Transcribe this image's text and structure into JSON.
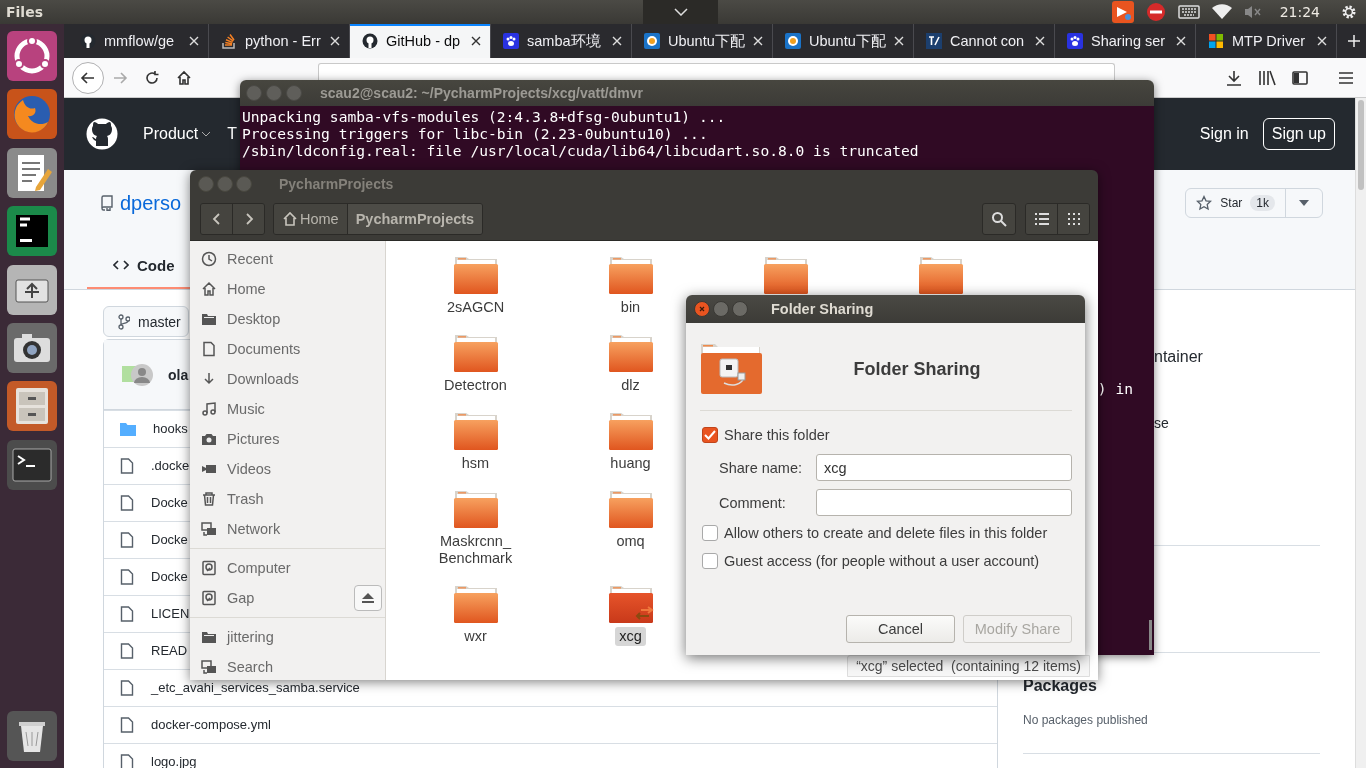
{
  "top_panel": {
    "app_title": "Files",
    "clock": "21:24"
  },
  "browser": {
    "tabs": [
      {
        "kind": "circle",
        "label": "mmflow/ge",
        "selected": false
      },
      {
        "kind": "stack",
        "label": "python - Err",
        "selected": false
      },
      {
        "kind": "circle",
        "label": "GitHub - dp",
        "selected": true
      },
      {
        "kind": "paw",
        "label": "samba环境",
        "selected": false
      },
      {
        "kind": "ring",
        "label": "Ubuntu下配",
        "selected": false
      },
      {
        "kind": "ring",
        "label": "Ubuntu下配",
        "selected": false
      },
      {
        "kind": "slash",
        "label": "Cannot con",
        "selected": false
      },
      {
        "kind": "paw",
        "label": "Sharing ser",
        "selected": false
      },
      {
        "kind": "squares",
        "label": "MTP Driver",
        "selected": false
      }
    ]
  },
  "github": {
    "nav": [
      "Product",
      "T"
    ],
    "sign_in": "Sign in",
    "sign_up": "Sign up",
    "owner": "dperso",
    "star": "Star",
    "star_count": "1k",
    "tabs": [
      {
        "label": "Code",
        "selected": true
      }
    ],
    "branch": "master",
    "author": "ola",
    "files": [
      {
        "kind": "folder",
        "name": "hooks"
      },
      {
        "kind": "file",
        "name": ".docke"
      },
      {
        "kind": "file",
        "name": "Docke"
      },
      {
        "kind": "file",
        "name": "Docke"
      },
      {
        "kind": "file",
        "name": "Docke"
      },
      {
        "kind": "file",
        "name": "LICEN"
      },
      {
        "kind": "file",
        "name": "READ"
      },
      {
        "kind": "file",
        "name": "_etc_avahi_services_samba.service"
      },
      {
        "kind": "file",
        "name": "docker-compose.yml"
      },
      {
        "kind": "file",
        "name": "logo.jpg"
      }
    ],
    "about_fragments": [
      "ntainer",
      "se"
    ],
    "packages_title": "Packages",
    "packages_note": "No packages published"
  },
  "terminal": {
    "title": "scau2@scau2: ~/PycharmProjects/xcg/vatt/dmvr",
    "lines": [
      "Unpacking samba-vfs-modules (2:4.3.8+dfsg-0ubuntu1) ...",
      "Processing triggers for libc-bin (2.23-0ubuntu10) ...",
      "/sbin/ldconfig.real: file /usr/local/cuda/lib64/libcudart.so.8.0 is truncated"
    ],
    "tail": ") in"
  },
  "files": {
    "title": "PycharmProjects",
    "path": [
      {
        "label": "Home",
        "selected": false
      },
      {
        "label": "PycharmProjects",
        "selected": true
      }
    ],
    "sidebar": [
      {
        "items": [
          {
            "kind": "recent",
            "label": "Recent"
          },
          {
            "kind": "home",
            "label": "Home"
          },
          {
            "kind": "folder",
            "label": "Desktop"
          },
          {
            "kind": "document",
            "label": "Documents"
          },
          {
            "kind": "download",
            "label": "Downloads"
          },
          {
            "kind": "music",
            "label": "Music"
          },
          {
            "kind": "camera",
            "label": "Pictures"
          },
          {
            "kind": "video",
            "label": "Videos"
          },
          {
            "kind": "trash",
            "label": "Trash"
          },
          {
            "kind": "network",
            "label": "Network"
          }
        ]
      },
      {
        "items": [
          {
            "kind": "drive",
            "label": "Computer"
          },
          {
            "kind": "mount",
            "label": "Gap"
          }
        ]
      },
      {
        "items": [
          {
            "kind": "folder",
            "label": "jittering"
          },
          {
            "kind": "network",
            "label": "Search"
          }
        ]
      }
    ],
    "rows": [
      [
        {
          "name": "2sAGCN",
          "selected": false,
          "shared": false
        },
        {
          "name": "bin",
          "selected": false,
          "shared": false
        },
        {
          "shared": false
        },
        {
          "shared": false
        }
      ],
      [
        {
          "name": "Detectron",
          "selected": false,
          "shared": false
        },
        {
          "name": "dlz",
          "selected": false,
          "shared": false
        }
      ],
      [
        {
          "name": "hsm",
          "selected": false,
          "shared": false
        },
        {
          "name": "huang",
          "selected": false,
          "shared": false
        }
      ],
      [
        {
          "name": "Maskrcnn_Benchmark",
          "selected": false,
          "shared": false
        },
        {
          "name": "omq",
          "selected": false,
          "shared": false
        }
      ],
      [
        {
          "name": "wxr",
          "selected": false,
          "shared": false
        },
        {
          "name": "xcg",
          "selected": true,
          "shared": true
        }
      ]
    ],
    "status": "“xcg” selected  (containing 12 items)"
  },
  "share_dialog": {
    "title": "Folder Sharing",
    "heading": "Folder Sharing",
    "options": [
      {
        "kind": "checkbox",
        "label": "Share this folder",
        "checked": true
      },
      {
        "kind": "field",
        "label": "Share name:",
        "value": "xcg"
      },
      {
        "kind": "field",
        "label": "Comment:"
      },
      {
        "kind": "checkbox",
        "label": "Allow others to create and delete files in this folder",
        "checked": false
      },
      {
        "kind": "checkbox",
        "label": "Guest access (for people without a user account)",
        "checked": false
      }
    ],
    "buttons": [
      {
        "label": "Cancel",
        "disabled": false
      },
      {
        "label": "Modify Share",
        "disabled": true
      }
    ]
  }
}
